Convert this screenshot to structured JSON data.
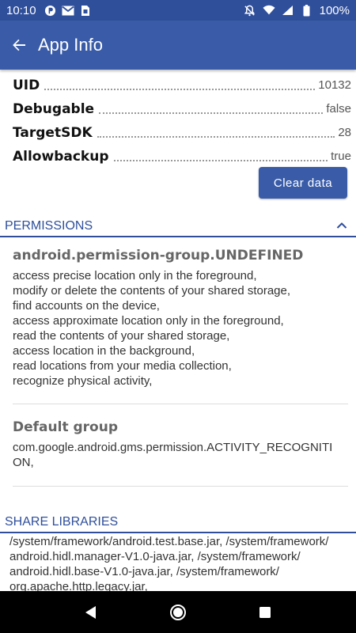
{
  "status_bar": {
    "time": "10:10",
    "battery": "100%",
    "left_icons": [
      "circle-p-icon",
      "gmail-icon",
      "sim-icon"
    ],
    "right_icons": [
      "dnd-off-icon",
      "wifi-icon",
      "signal-icon",
      "battery-icon"
    ]
  },
  "app_bar": {
    "title": "App Info",
    "back_icon": "arrow-back-icon",
    "color": "#3a5ca8"
  },
  "info": {
    "rows": [
      {
        "key": "UID",
        "value": "10132"
      },
      {
        "key": "Debugable",
        "value": "false"
      },
      {
        "key": "TargetSDK",
        "value": "28"
      },
      {
        "key": "Allowbackup",
        "value": "true"
      }
    ],
    "clear_button": "Clear data"
  },
  "permissions": {
    "header": "PERMISSIONS",
    "groups": [
      {
        "title": "android.permission-group.UNDEFINED",
        "items": [
          "access precise location only in the foreground,",
          "modify or delete the contents of your shared storage,",
          "find accounts on the device,",
          "access approximate location only in the foreground,",
          "read the contents of your shared storage,",
          "access location in the background,",
          "read locations from your media collection,",
          "recognize physical activity,"
        ]
      },
      {
        "title": "Default group",
        "items": [
          "com.google.android.gms.permission.ACTIVITY_RECOGNITI",
          "ON,"
        ]
      }
    ]
  },
  "share_libraries": {
    "header": "SHARE LIBRARIES",
    "lines": [
      "/system/framework/android.test.base.jar, /system/framework/",
      "android.hidl.manager-V1.0-java.jar, /system/framework/",
      "android.hidl.base-V1.0-java.jar, /system/framework/",
      "org.apache.http.legacy.jar,"
    ]
  },
  "nav_bar": {
    "buttons": [
      "back-icon",
      "home-icon",
      "recents-icon"
    ]
  }
}
